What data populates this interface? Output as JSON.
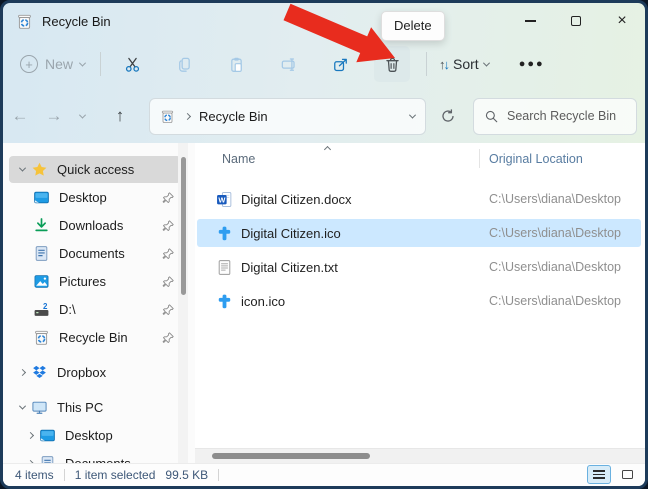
{
  "window": {
    "title": "Recycle Bin",
    "close_glyph": "×"
  },
  "tooltip": {
    "label": "Delete"
  },
  "toolbar": {
    "new_label": "New",
    "sort_label": "Sort",
    "more_glyph": "●●●",
    "sort_up_glyph": "↑",
    "sort_down_glyph": "↓",
    "buttons": [
      "new",
      "cut",
      "copy",
      "paste",
      "rename",
      "share",
      "delete",
      "sort",
      "more"
    ]
  },
  "address_bar": {
    "back_glyph": "←",
    "forward_glyph": "→",
    "up_glyph": "↑",
    "breadcrumb": "Recycle Bin",
    "search_placeholder": "Search Recycle Bin"
  },
  "sidebar": {
    "items": [
      {
        "label": "Quick access",
        "icon": "star",
        "selected": true,
        "expanded": true
      },
      {
        "label": "Desktop",
        "icon": "desktop",
        "pinned": true
      },
      {
        "label": "Downloads",
        "icon": "downloads",
        "pinned": true
      },
      {
        "label": "Documents",
        "icon": "documents",
        "pinned": true
      },
      {
        "label": "Pictures",
        "icon": "pictures",
        "pinned": true
      },
      {
        "label": "D:\\",
        "icon": "drive",
        "pinned": true
      },
      {
        "label": "Recycle Bin",
        "icon": "recycle-bin",
        "pinned": true
      },
      {
        "label": "Dropbox",
        "icon": "dropbox",
        "collapsed": true
      },
      {
        "label": "This PC",
        "icon": "this-pc",
        "expanded": true
      },
      {
        "label": "Desktop",
        "icon": "desktop",
        "collapsed": true
      },
      {
        "label": "Documents",
        "icon": "documents",
        "collapsed": true
      }
    ]
  },
  "file_list": {
    "columns": {
      "name": "Name",
      "location": "Original Location"
    },
    "sorted_by": "Name",
    "rows": [
      {
        "name": "Digital Citizen.docx",
        "icon": "word-document",
        "location": "C:\\Users\\diana\\Desktop",
        "selected": false
      },
      {
        "name": "Digital Citizen.ico",
        "icon": "ico-image",
        "location": "C:\\Users\\diana\\Desktop",
        "selected": true
      },
      {
        "name": "Digital Citizen.txt",
        "icon": "text-document",
        "location": "C:\\Users\\diana\\Desktop",
        "selected": false
      },
      {
        "name": "icon.ico",
        "icon": "ico-image",
        "location": "C:\\Users\\diana\\Desktop",
        "selected": false
      }
    ]
  },
  "status_bar": {
    "items_count": "4 items",
    "selection_count": "1 item selected",
    "selection_size": "99.5 KB"
  },
  "annotation": {
    "type": "red-arrow",
    "color": "#e82c1e",
    "target": "delete-button"
  },
  "colors": {
    "selected_row": "#cce8ff",
    "accent_blue": "#1878be",
    "quick_access_bg": "#d9d9d9",
    "window_border": "#1d3b5a"
  }
}
